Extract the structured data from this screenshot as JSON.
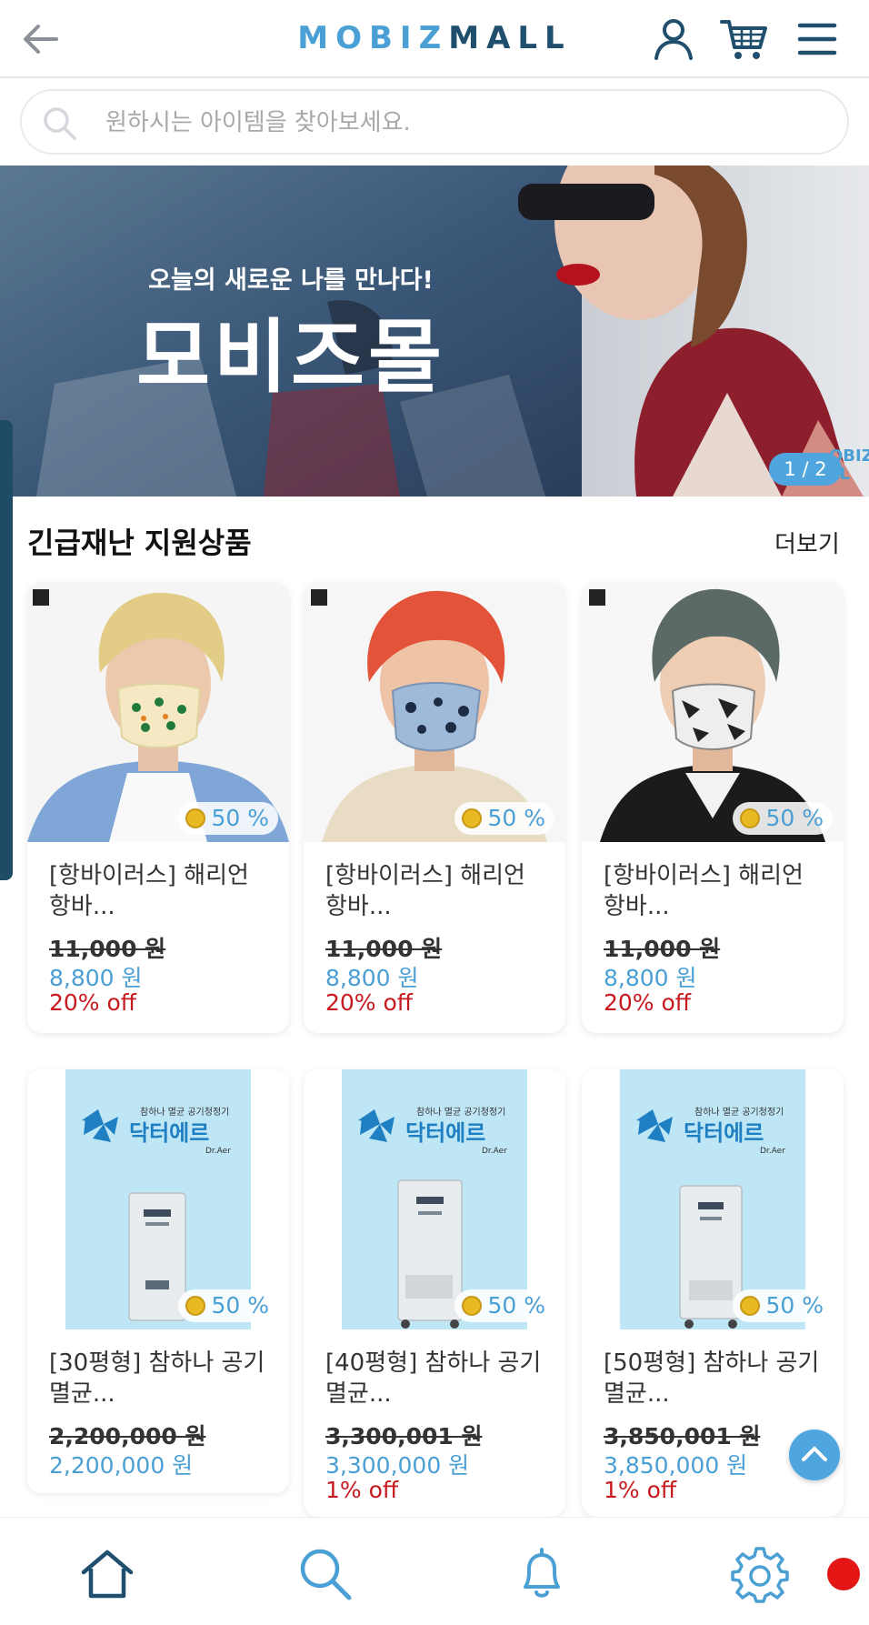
{
  "header": {
    "logo_part1": "MOBIZ",
    "logo_part2": "MALL",
    "icons": [
      "back-arrow-icon",
      "user-icon",
      "cart-icon",
      "menu-icon"
    ]
  },
  "search": {
    "placeholder": "원하시는 아이템을 찾아보세요."
  },
  "banner": {
    "subtitle": "오늘의 새로운 나를 만나다!",
    "title": "모비즈몰",
    "pager": "1 / 2",
    "mark": "OBIZ\nLL"
  },
  "section": {
    "title": "긴급재난 지원상품",
    "more": "더보기"
  },
  "products": [
    {
      "name": "[항바이러스] 해리언 항바...",
      "discount_badge": "50 %",
      "original_price": "11,000 원",
      "sale_price": "8,800 원",
      "off": "20% off"
    },
    {
      "name": "[항바이러스] 해리언 항바...",
      "discount_badge": "50 %",
      "original_price": "11,000 원",
      "sale_price": "8,800 원",
      "off": "20% off"
    },
    {
      "name": "[항바이러스] 해리언 항바...",
      "discount_badge": "50 %",
      "original_price": "11,000 원",
      "sale_price": "8,800 원",
      "off": "20% off"
    },
    {
      "name": "[30평형] 참하나 공기멸균...",
      "discount_badge": "50 %",
      "original_price": "2,200,000 원",
      "sale_price": "2,200,000 원",
      "off": ""
    },
    {
      "name": "[40평형] 참하나 공기멸균...",
      "discount_badge": "50 %",
      "original_price": "3,300,001 원",
      "sale_price": "3,300,000 원",
      "off": "1% off"
    },
    {
      "name": "[50평형] 참하나 공기멸균...",
      "discount_badge": "50 %",
      "original_price": "3,850,001 원",
      "sale_price": "3,850,000 원",
      "off": "1% off"
    }
  ],
  "purifier_poster": {
    "top_line": "참하나 멸균 공기청정기",
    "brand": "닥터에르",
    "brand_en": "Dr.Aer"
  },
  "bottom_nav": {
    "icons": [
      "home-icon",
      "search-icon",
      "bell-icon",
      "gear-icon"
    ]
  },
  "colors": {
    "accent": "#4a9fd4",
    "brand_dark": "#1f4f6d",
    "off_red": "#c8191e",
    "notification_dot": "#e31515"
  }
}
